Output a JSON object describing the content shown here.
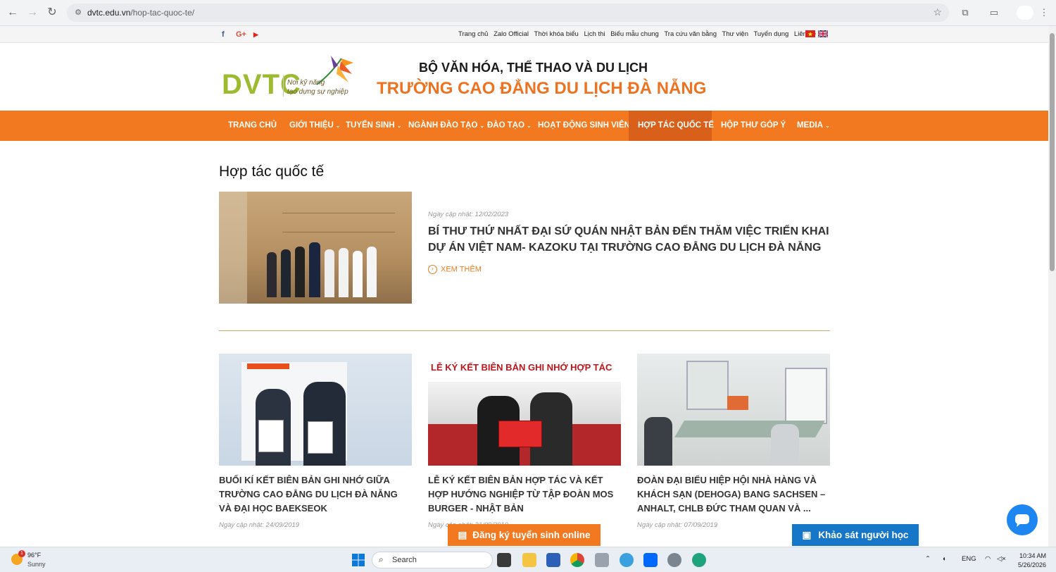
{
  "browser": {
    "url_domain": "dvtc.edu.vn",
    "url_path": "/hop-tac-quoc-te/"
  },
  "topbar": {
    "links": [
      "Trang chủ",
      "Zalo Official",
      "Thời khóa biểu",
      "Lịch thi",
      "Biểu mẫu chung",
      "Tra cứu văn bằng",
      "Thư viện",
      "Tuyển dụng",
      "Liên hệ"
    ],
    "social": [
      "f",
      "G+",
      "▶"
    ]
  },
  "header": {
    "logo": "DVTC",
    "slogan_1": "Nơi kỹ năng",
    "slogan_2": "tạo dựng sự nghiệp",
    "ministry": "BỘ VĂN HÓA, THỂ THAO VÀ DU LỊCH",
    "school": "TRƯỜNG CAO ĐẲNG DU LỊCH ĐÀ NẴNG"
  },
  "nav": {
    "items": [
      "TRANG CHỦ",
      "GIỚI THIỆU",
      "TUYỂN SINH",
      "NGÀNH ĐÀO TẠO",
      "ĐÀO TẠO",
      "HOẠT ĐỘNG SINH VIÊN",
      "HỢP TÁC QUỐC TẾ",
      "HỘP THƯ GÓP Ý",
      "MEDIA"
    ]
  },
  "content": {
    "page_title": "Hợp tác quốc tế",
    "featured": {
      "date": "Ngày cập nhật: 12/02/2023",
      "title": "BÍ THƯ THỨ NHẤT ĐẠI SỨ QUÁN NHẬT BẢN ĐẾN THĂM VIỆC TRIỂN KHAI DỰ ÁN VIỆT NAM- KAZOKU TẠI TRƯỜNG CAO ĐẲNG DU LỊCH ĐÀ NẴNG",
      "more": "XEM THÊM"
    },
    "cards": [
      {
        "title": "BUỔI KÍ KẾT BIÊN BẢN GHI NHỚ GIỮA TRƯỜNG CAO ĐẲNG DU LỊCH ĐÀ NẴNG VÀ ĐẠI HỌC BAEKSEOK",
        "date": "Ngày cập nhật: 24/09/2019"
      },
      {
        "title": "LỄ KÝ KẾT BIÊN BẢN HỢP TÁC VÀ KẾT HỢP HƯỚNG NGHIỆP TỪ TẬP ĐOÀN MOS BURGER - NHẬT BẢN",
        "date": "Ngày cập nhật: 21/09/2019"
      },
      {
        "title": "ĐOÀN ĐẠI BIỂU HIỆP HỘI NHÀ HÀNG VÀ KHÁCH SẠN (DEHOGA) BANG SACHSEN – ANHALT, CHLB ĐỨC THAM QUAN VÀ ...",
        "date": "Ngày cập nhật: 07/09/2019"
      }
    ],
    "card2_banner": "LỄ KÝ KẾT BIÊN BẢN GHI NHỚ HỢP TÁC"
  },
  "floating": {
    "register": "Đăng ký tuyển sinh online",
    "survey": "Khảo sát người học"
  },
  "taskbar": {
    "temp": "96°F",
    "condition": "Sunny",
    "weather_badge": "1",
    "search": "Search",
    "lang": "ENG",
    "time": "10:34 AM",
    "date": "5/26/2026"
  },
  "colors": {
    "brand_orange": "#f37920",
    "nav_active": "#d9601a",
    "logo_green": "#9dbb2f",
    "survey_blue": "#1677c8"
  }
}
